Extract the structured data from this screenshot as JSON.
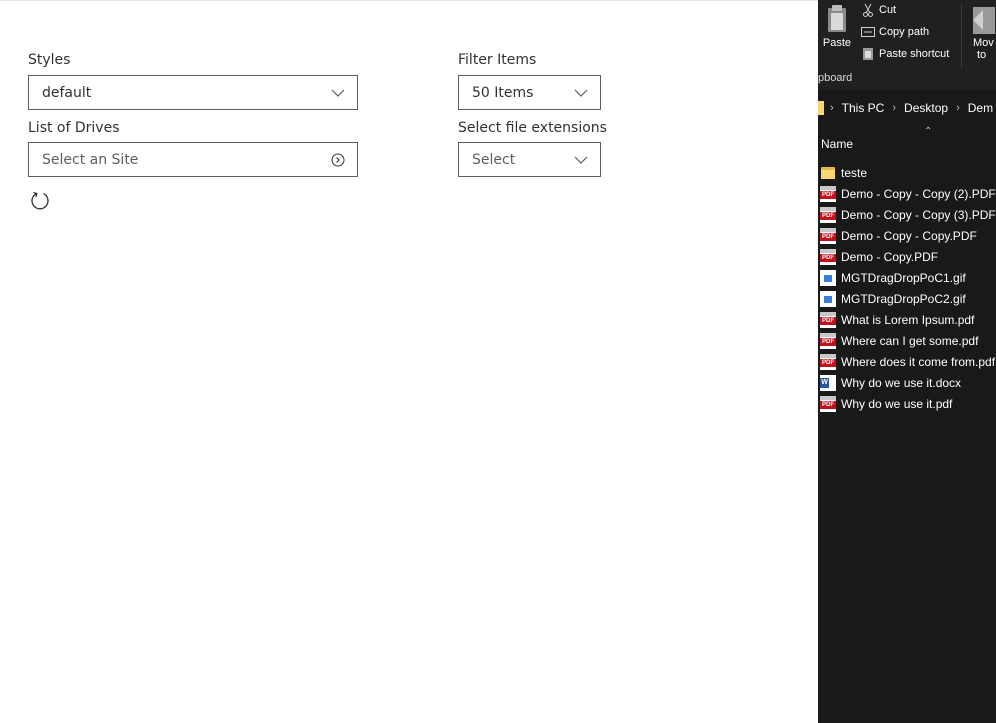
{
  "app": {
    "styles": {
      "label": "Styles",
      "value": "default"
    },
    "filter_items": {
      "label": "Filter Items",
      "value": "50 Items"
    },
    "list_of_drives": {
      "label": "List of Drives",
      "placeholder": "Select an Site"
    },
    "file_extensions": {
      "label": "Select file extensions",
      "placeholder": "Select"
    }
  },
  "explorer": {
    "ribbon": {
      "paste": "Paste",
      "cut": "Cut",
      "copy_path": "Copy path",
      "paste_shortcut": "Paste shortcut",
      "move_to_line1": "Mov",
      "move_to_line2": "to",
      "group_label": "pboard"
    },
    "breadcrumb": [
      "This PC",
      "Desktop",
      "Dem"
    ],
    "column_header": "Name",
    "files": [
      {
        "name": "teste",
        "type": "folder"
      },
      {
        "name": "Demo - Copy - Copy (2).PDF",
        "type": "pdf"
      },
      {
        "name": "Demo - Copy - Copy (3).PDF",
        "type": "pdf"
      },
      {
        "name": "Demo - Copy - Copy.PDF",
        "type": "pdf"
      },
      {
        "name": "Demo - Copy.PDF",
        "type": "pdf"
      },
      {
        "name": "MGTDragDropPoC1.gif",
        "type": "gif"
      },
      {
        "name": "MGTDragDropPoC2.gif",
        "type": "gif"
      },
      {
        "name": "What is Lorem Ipsum.pdf",
        "type": "pdf"
      },
      {
        "name": "Where can I get some.pdf",
        "type": "pdf"
      },
      {
        "name": "Where does it come from.pdf",
        "type": "pdf"
      },
      {
        "name": "Why do we use it.docx",
        "type": "docx"
      },
      {
        "name": "Why do we use it.pdf",
        "type": "pdf"
      }
    ]
  },
  "colors": {
    "border": "#605e5c",
    "text": "#323130",
    "explorer_bg": "#191919",
    "pdf_red": "#c1121c",
    "folder_yellow": "#f8d775",
    "word_blue": "#2b579a"
  },
  "icons": [
    "chevron-down-icon",
    "navigate-circle-icon",
    "refresh-icon",
    "clipboard-icon",
    "scissors-icon",
    "copy-path-icon",
    "paste-shortcut-icon",
    "move-to-icon",
    "folder-icon",
    "pdf-icon",
    "gif-image-icon",
    "word-doc-icon",
    "sort-arrow-up-icon"
  ]
}
